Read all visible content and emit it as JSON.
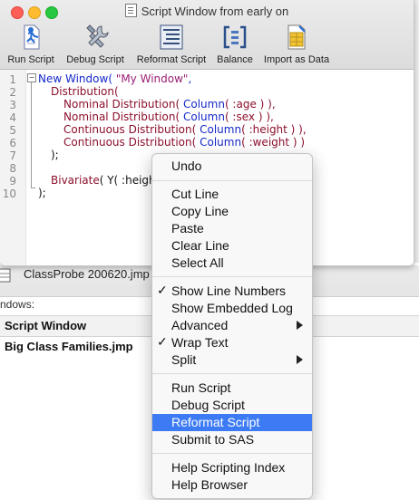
{
  "window": {
    "title": "Script Window from early on",
    "toolbar": [
      {
        "label": "Run Script",
        "icon": "run-script-icon"
      },
      {
        "label": "Debug Script",
        "icon": "debug-script-icon"
      },
      {
        "label": "Reformat Script",
        "icon": "reformat-script-icon"
      },
      {
        "label": "Balance",
        "icon": "balance-icon"
      },
      {
        "label": "Import as Data",
        "icon": "import-data-icon"
      }
    ]
  },
  "code": {
    "line_numbers": [
      "1",
      "2",
      "3",
      "4",
      "5",
      "6",
      "7",
      "8",
      "9",
      "10"
    ],
    "lines": {
      "l1": {
        "a": "New Window",
        "b": "( ",
        "c": "\"My Window\"",
        "d": ","
      },
      "l2": {
        "a": "Distribution",
        "b": "("
      },
      "l3": {
        "a": "Nominal Distribution",
        "b": "( ",
        "c": "Column",
        "d": "( :age ) ),"
      },
      "l4": {
        "a": "Nominal Distribution",
        "b": "( ",
        "c": "Column",
        "d": "( :sex ) ),"
      },
      "l5": {
        "a": "Continuous Distribution",
        "b": "( ",
        "c": "Column",
        "d": "( :height ) ),"
      },
      "l6": {
        "a": "Continuous Distribution",
        "b": "( ",
        "c": "Column",
        "d": "( :weight ) )"
      },
      "l7": {
        "a": ");"
      },
      "l9": {
        "a": "Bivariate",
        "b": "( Y( :heigh"
      },
      "l10": {
        "a": ");"
      }
    }
  },
  "background": {
    "probe_file": "ClassProbe 200620.jmp",
    "windows_label": "ndows:",
    "list_header": "Script Window",
    "list_row": "Big Class Families.jmp"
  },
  "context_menu": {
    "items": [
      {
        "label": "Undo"
      },
      {
        "label": "Cut Line"
      },
      {
        "label": "Copy Line"
      },
      {
        "label": "Paste"
      },
      {
        "label": "Clear Line"
      },
      {
        "label": "Select All"
      },
      {
        "label": "Show Line Numbers",
        "checked": true
      },
      {
        "label": "Show Embedded Log"
      },
      {
        "label": "Advanced",
        "submenu": true
      },
      {
        "label": "Wrap Text",
        "checked": true
      },
      {
        "label": "Split",
        "submenu": true
      },
      {
        "label": "Run Script"
      },
      {
        "label": "Debug Script"
      },
      {
        "label": "Reformat Script",
        "highlighted": true
      },
      {
        "label": "Submit to SAS"
      },
      {
        "label": "Help Scripting Index"
      },
      {
        "label": "Help Browser"
      }
    ],
    "check_mark": "✓"
  },
  "colors": {
    "highlight": "#3d7bf5",
    "keyword_blue": "#1428c8",
    "function_red": "#8b0f2b",
    "string_purple": "#9a1f74"
  }
}
